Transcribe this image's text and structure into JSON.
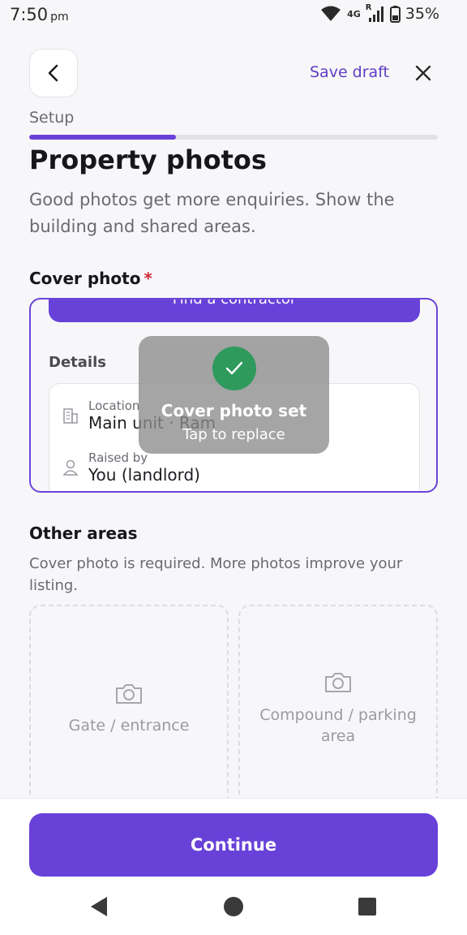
{
  "status_bar": {
    "time": "7:50",
    "ampm": "pm",
    "network": "4G",
    "roaming": "R",
    "battery": "35%"
  },
  "header": {
    "back_icon": "chevron-left-icon",
    "save_draft": "Save draft",
    "close_icon": "close-icon"
  },
  "progress": {
    "step_label": "Setup",
    "fraction": 0.36
  },
  "page": {
    "title": "Property photos",
    "subtitle": "Good photos get more enquiries. Show the building and shared areas."
  },
  "cover": {
    "label": "Cover photo",
    "required_mark": "*",
    "preview": {
      "button_label": "Find a contractor",
      "details_title": "Details",
      "location_label": "Location",
      "location_value": "Main unit · Ram",
      "raised_by_label": "Raised by",
      "raised_by_value": "You (landlord)"
    },
    "toast": {
      "title": "Cover photo set",
      "subtitle": "Tap to replace"
    }
  },
  "other_areas": {
    "title": "Other areas",
    "description": "Cover photo is required. More photos improve your listing.",
    "slots": [
      {
        "label": "Gate / entrance",
        "icon": "camera-icon"
      },
      {
        "label": "Compound / parking area",
        "icon": "camera-icon"
      }
    ]
  },
  "footer": {
    "continue_label": "Continue"
  },
  "colors": {
    "accent": "#6841d9",
    "success": "#2e9a5c",
    "required": "#d2293a"
  }
}
